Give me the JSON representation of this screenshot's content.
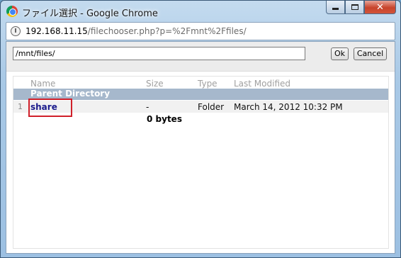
{
  "window": {
    "title": "ファイル選択 - Google Chrome",
    "minimize_label": "",
    "maximize_label": "",
    "close_label": "✕"
  },
  "address": {
    "host": "192.168.11.15",
    "path": "/filechooser.php?p=%2Fmnt%2Ffiles/"
  },
  "toolbar": {
    "path_value": "/mnt/files/",
    "ok_label": "Ok",
    "cancel_label": "Cancel"
  },
  "table": {
    "headers": {
      "name": "Name",
      "size": "Size",
      "type": "Type",
      "modified": "Last Modified"
    },
    "parent_label": "Parent Directory",
    "rows": [
      {
        "num": "1",
        "name": "share",
        "size": "-",
        "type": "Folder",
        "modified": "March 14, 2012 10:32 PM"
      }
    ],
    "total": "0 bytes"
  },
  "colors": {
    "highlight": "#d0202a",
    "parent_row": "#a6b8cc",
    "link": "#1a1a8c"
  }
}
